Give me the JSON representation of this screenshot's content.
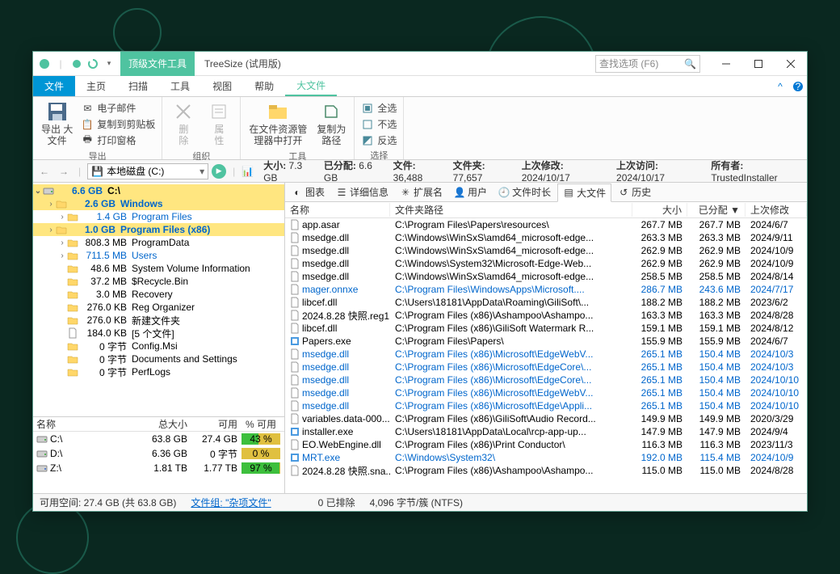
{
  "title": {
    "tool_group": "顶级文件工具",
    "app": "TreeSize  (试用版)"
  },
  "search_placeholder": "查找选项 (F6)",
  "menu": {
    "file": "文件",
    "home": "主页",
    "scan": "扫描",
    "tools": "工具",
    "view": "视图",
    "help": "帮助",
    "bigfiles": "大文件"
  },
  "ribbon": {
    "export_big": "导出 大\n文件",
    "email": "电子邮件",
    "copy_clip": "复制到剪贴板",
    "print_grid": "打印窗格",
    "g_export": "导出",
    "delete": "删\n除",
    "props": "属\n性",
    "g_org": "组织",
    "open_explorer": "在文件资源管\n理器中打开",
    "copy_path": "复制为\n路径",
    "g_tools": "工具",
    "sel_all": "全选",
    "sel_none": "不选",
    "sel_inv": "反选",
    "g_sel": "选择"
  },
  "path": "本地磁盘 (C:)",
  "stats": {
    "size_lbl": "大小:",
    "size_val": "7.3 GB",
    "alloc_lbl": "已分配:",
    "alloc_val": "6.6 GB",
    "files_lbl": "文件:",
    "files_val": "36,488",
    "dirs_lbl": "文件夹:",
    "dirs_val": "77,657",
    "mod_lbl": "上次修改:",
    "mod_val": "2024/10/17",
    "acc_lbl": "上次访问:",
    "acc_val": "2024/10/17",
    "own_lbl": "所有者:",
    "own_val": "TrustedInstaller"
  },
  "tree": [
    {
      "lvl": 0,
      "cls": "root",
      "exp": "v",
      "ico": "drive",
      "size": "6.6 GB",
      "name": "C:\\"
    },
    {
      "lvl": 1,
      "cls": "hl",
      "exp": ">",
      "ico": "folder",
      "size": "2.6 GB",
      "name": "Windows"
    },
    {
      "lvl": 2,
      "cls": "hl2",
      "exp": ">",
      "ico": "folder",
      "size": "1.4 GB",
      "name": "Program Files"
    },
    {
      "lvl": 1,
      "cls": "hl",
      "exp": ">",
      "ico": "folder",
      "size": "1.0 GB",
      "name": "Program Files (x86)"
    },
    {
      "lvl": 2,
      "cls": "",
      "exp": ">",
      "ico": "folder",
      "size": "808.3 MB",
      "name": "ProgramData"
    },
    {
      "lvl": 2,
      "cls": "hl2",
      "exp": ">",
      "ico": "folder",
      "size": "711.5 MB",
      "name": "Users"
    },
    {
      "lvl": 2,
      "cls": "",
      "exp": "",
      "ico": "folder",
      "size": "48.6 MB",
      "name": "System Volume Information"
    },
    {
      "lvl": 2,
      "cls": "",
      "exp": "",
      "ico": "folder",
      "size": "37.2 MB",
      "name": "$Recycle.Bin"
    },
    {
      "lvl": 2,
      "cls": "",
      "exp": "",
      "ico": "folder",
      "size": "3.0 MB",
      "name": "Recovery"
    },
    {
      "lvl": 2,
      "cls": "",
      "exp": "",
      "ico": "folder",
      "size": "276.0 KB",
      "name": "Reg Organizer"
    },
    {
      "lvl": 2,
      "cls": "",
      "exp": "",
      "ico": "folder",
      "size": "276.0 KB",
      "name": "新建文件夹"
    },
    {
      "lvl": 2,
      "cls": "",
      "exp": "",
      "ico": "file",
      "size": "184.0 KB",
      "name": "[5 个文件]"
    },
    {
      "lvl": 2,
      "cls": "",
      "exp": "",
      "ico": "folder",
      "size": "0 字节",
      "name": "Config.Msi"
    },
    {
      "lvl": 2,
      "cls": "",
      "exp": "",
      "ico": "folder",
      "size": "0 字节",
      "name": "Documents and Settings"
    },
    {
      "lvl": 2,
      "cls": "",
      "exp": "",
      "ico": "folder",
      "size": "0 字节",
      "name": "PerfLogs"
    }
  ],
  "drive_head": {
    "name": "名称",
    "total": "总大小",
    "free": "可用",
    "pct": "% 可用"
  },
  "drives": [
    {
      "ico": "drive",
      "name": "C:\\",
      "total": "63.8 GB",
      "free": "27.4 GB",
      "pct": 43,
      "pct_txt": "43 %"
    },
    {
      "ico": "drive",
      "name": "D:\\",
      "total": "6.36 GB",
      "free": "0 字节",
      "pct": 0,
      "pct_txt": "0 %"
    },
    {
      "ico": "net",
      "name": "Z:\\",
      "total": "1.81 TB",
      "free": "1.77 TB",
      "pct": 97,
      "pct_txt": "97 %"
    }
  ],
  "vtabs": {
    "chart": "图表",
    "details": "详细信息",
    "ext": "扩展名",
    "users": "用户",
    "age": "文件时长",
    "big": "大文件",
    "hist": "历史"
  },
  "fhead": {
    "name": "名称",
    "path": "文件夹路径",
    "size": "大小",
    "alloc": "已分配 ▼",
    "date": "上次修改"
  },
  "files": [
    {
      "ico": "f",
      "name": "app.asar",
      "path": "C:\\Program Files\\Papers\\resources\\",
      "size": "267.7 MB",
      "alloc": "267.7 MB",
      "date": "2024/6/7"
    },
    {
      "ico": "f",
      "name": "msedge.dll",
      "path": "C:\\Windows\\WinSxS\\amd64_microsoft-edge...",
      "size": "263.3 MB",
      "alloc": "263.3 MB",
      "date": "2024/9/11"
    },
    {
      "ico": "f",
      "name": "msedge.dll",
      "path": "C:\\Windows\\WinSxS\\amd64_microsoft-edge...",
      "size": "262.9 MB",
      "alloc": "262.9 MB",
      "date": "2024/10/9"
    },
    {
      "ico": "f",
      "name": "msedge.dll",
      "path": "C:\\Windows\\System32\\Microsoft-Edge-Web...",
      "size": "262.9 MB",
      "alloc": "262.9 MB",
      "date": "2024/10/9"
    },
    {
      "ico": "f",
      "name": "msedge.dll",
      "path": "C:\\Windows\\WinSxS\\amd64_microsoft-edge...",
      "size": "258.5 MB",
      "alloc": "258.5 MB",
      "date": "2024/8/14"
    },
    {
      "ico": "f",
      "cls": "link",
      "name": "mager.onnxe",
      "path": "C:\\Program Files\\WindowsApps\\Microsoft....",
      "size": "286.7 MB",
      "alloc": "243.6 MB",
      "date": "2024/7/17"
    },
    {
      "ico": "f",
      "name": "libcef.dll",
      "path": "C:\\Users\\18181\\AppData\\Roaming\\GiliSoft\\...",
      "size": "188.2 MB",
      "alloc": "188.2 MB",
      "date": "2023/6/2"
    },
    {
      "ico": "f",
      "name": "2024.8.28 快照.reg1",
      "path": "C:\\Program Files (x86)\\Ashampoo\\Ashampo...",
      "size": "163.3 MB",
      "alloc": "163.3 MB",
      "date": "2024/8/28"
    },
    {
      "ico": "f",
      "name": "libcef.dll",
      "path": "C:\\Program Files (x86)\\GiliSoft Watermark R...",
      "size": "159.1 MB",
      "alloc": "159.1 MB",
      "date": "2024/8/12"
    },
    {
      "ico": "exe",
      "name": "Papers.exe",
      "path": "C:\\Program Files\\Papers\\",
      "size": "155.9 MB",
      "alloc": "155.9 MB",
      "date": "2024/6/7"
    },
    {
      "ico": "f",
      "cls": "link",
      "name": "msedge.dll",
      "path": "C:\\Program Files (x86)\\Microsoft\\EdgeWebV...",
      "size": "265.1 MB",
      "alloc": "150.4 MB",
      "date": "2024/10/3"
    },
    {
      "ico": "f",
      "cls": "link",
      "name": "msedge.dll",
      "path": "C:\\Program Files (x86)\\Microsoft\\EdgeCore\\...",
      "size": "265.1 MB",
      "alloc": "150.4 MB",
      "date": "2024/10/3"
    },
    {
      "ico": "f",
      "cls": "link",
      "name": "msedge.dll",
      "path": "C:\\Program Files (x86)\\Microsoft\\EdgeCore\\...",
      "size": "265.1 MB",
      "alloc": "150.4 MB",
      "date": "2024/10/10"
    },
    {
      "ico": "f",
      "cls": "link",
      "name": "msedge.dll",
      "path": "C:\\Program Files (x86)\\Microsoft\\EdgeWebV...",
      "size": "265.1 MB",
      "alloc": "150.4 MB",
      "date": "2024/10/10"
    },
    {
      "ico": "f",
      "cls": "link",
      "name": "msedge.dll",
      "path": "C:\\Program Files (x86)\\Microsoft\\Edge\\Appli...",
      "size": "265.1 MB",
      "alloc": "150.4 MB",
      "date": "2024/10/10"
    },
    {
      "ico": "f",
      "name": "variables.data-000...",
      "path": "C:\\Program Files (x86)\\GiliSoft\\Audio Record...",
      "size": "149.9 MB",
      "alloc": "149.9 MB",
      "date": "2020/3/29"
    },
    {
      "ico": "exe",
      "name": "installer.exe",
      "path": "C:\\Users\\18181\\AppData\\Local\\rcp-app-up...",
      "size": "147.9 MB",
      "alloc": "147.9 MB",
      "date": "2024/9/4"
    },
    {
      "ico": "f",
      "name": "EO.WebEngine.dll",
      "path": "C:\\Program Files (x86)\\Print Conductor\\",
      "size": "116.3 MB",
      "alloc": "116.3 MB",
      "date": "2023/11/3"
    },
    {
      "ico": "exe",
      "cls": "link",
      "name": "MRT.exe",
      "path": "C:\\Windows\\System32\\",
      "size": "192.0 MB",
      "alloc": "115.4 MB",
      "date": "2024/10/9"
    },
    {
      "ico": "f",
      "name": "2024.8.28 快照.sna...",
      "path": "C:\\Program Files (x86)\\Ashampoo\\Ashampo...",
      "size": "115.0 MB",
      "alloc": "115.0 MB",
      "date": "2024/8/28"
    }
  ],
  "status": {
    "free": "可用空间: 27.4 GB  (共 63.8 GB)",
    "filter_lbl": "文件组:",
    "filter_val": "\"杂项文件\"",
    "excluded": "0 已排除",
    "cluster": "4,096 字节/簇 (NTFS)"
  }
}
